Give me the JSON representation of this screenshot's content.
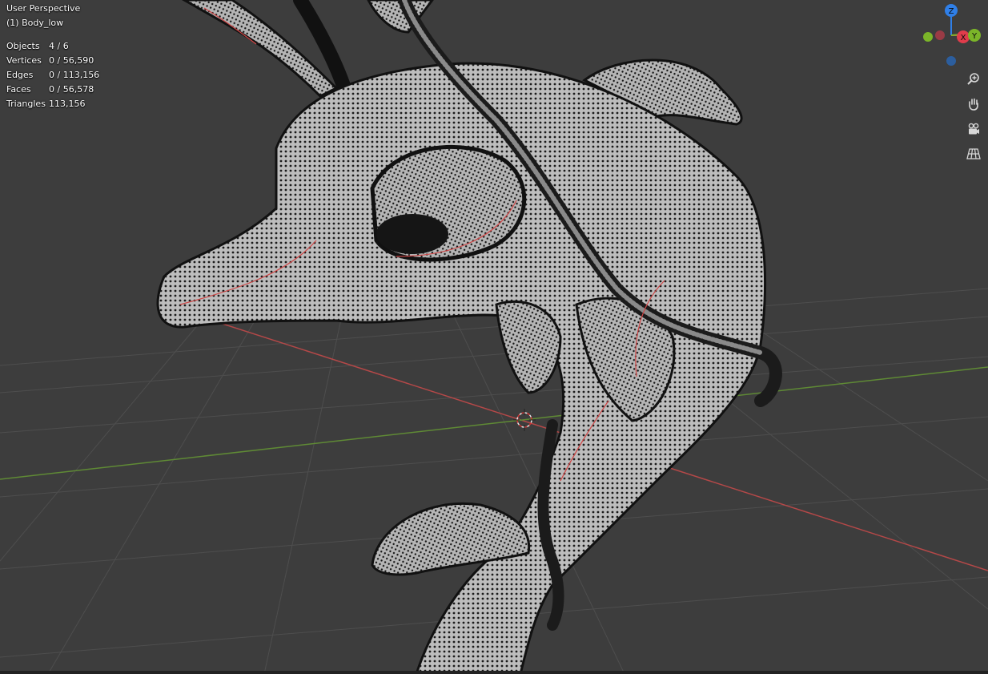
{
  "viewport": {
    "view_name": "User Perspective",
    "object_name": "(1) Body_low",
    "background_color": "#3d3d3d",
    "mesh_color": "#b8b8b8",
    "seam_color": "#d04040",
    "x_axis_color": "#c9504f",
    "y_axis_color": "#6a9a3a"
  },
  "stats": [
    {
      "label": "Objects",
      "value": "4 / 6"
    },
    {
      "label": "Vertices",
      "value": "0 / 56,590"
    },
    {
      "label": "Edges",
      "value": "0 / 113,156"
    },
    {
      "label": "Faces",
      "value": "0 / 56,578"
    },
    {
      "label": "Triangles",
      "value": "113,156"
    }
  ],
  "gizmo": {
    "axes": [
      {
        "label": "Z",
        "color": "#2f7fe8"
      },
      {
        "label": "X",
        "color": "#e03c4b"
      },
      {
        "label": "Y",
        "color": "#7bb529"
      }
    ],
    "buttons": [
      {
        "icon": "zoom-icon"
      },
      {
        "icon": "hand-pan-icon"
      },
      {
        "icon": "camera-icon"
      },
      {
        "icon": "grid-perspective-icon"
      }
    ]
  }
}
